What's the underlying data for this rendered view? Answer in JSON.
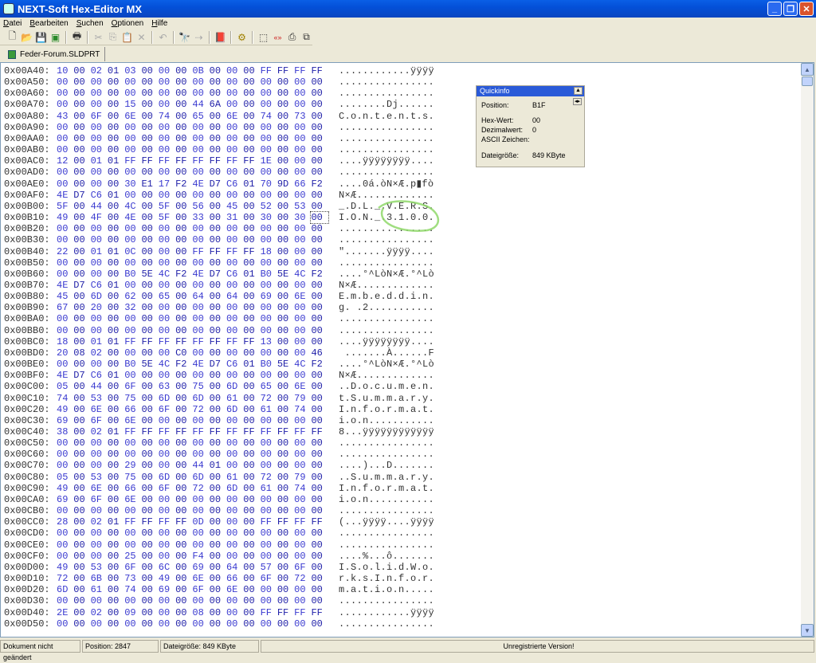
{
  "window": {
    "title": "NEXT-Soft Hex-Editor MX"
  },
  "menu": [
    "Datei",
    "Bearbeiten",
    "Suchen",
    "Optionen",
    "Hilfe"
  ],
  "tab": {
    "label": "Feder-Forum.SLDPRT"
  },
  "quickinfo": {
    "title": "Quickinfo",
    "position_label": "Position:",
    "position": "B1F",
    "hex_label": "Hex-Wert:",
    "hex": "00",
    "dec_label": "Dezimalwert:",
    "dec": "0",
    "ascii_label": "ASCII Zeichen:",
    "size_label": "Dateigröße:",
    "size": "849 KByte"
  },
  "status": {
    "doc": "Dokument nicht geändert",
    "position": "Position: 2847",
    "size": "Dateigröße: 849 KByte",
    "reg": "Unregistrierte Version!"
  },
  "colors": {
    "hex_even": "#3a3ad0",
    "hex_odd": "#1f1fa8",
    "annotation": "#8fd86a"
  },
  "cursor_offset": "0x00B1F",
  "rows": [
    [
      "0x00A40:",
      "10 00 02 01 03 00 00 00 0B 00 00 00 FF FF FF FF",
      "............ÿÿÿÿ"
    ],
    [
      "0x00A50:",
      "00 00 00 00 00 00 00 00 00 00 00 00 00 00 00 00",
      "................"
    ],
    [
      "0x00A60:",
      "00 00 00 00 00 00 00 00 00 00 00 00 00 00 00 00",
      "................"
    ],
    [
      "0x00A70:",
      "00 00 00 00 15 00 00 00 44 6A 00 00 00 00 00 00",
      "........Dj......"
    ],
    [
      "0x00A80:",
      "43 00 6F 00 6E 00 74 00 65 00 6E 00 74 00 73 00",
      "C.o.n.t.e.n.t.s."
    ],
    [
      "0x00A90:",
      "00 00 00 00 00 00 00 00 00 00 00 00 00 00 00 00",
      "................"
    ],
    [
      "0x00AA0:",
      "00 00 00 00 00 00 00 00 00 00 00 00 00 00 00 00",
      "................"
    ],
    [
      "0x00AB0:",
      "00 00 00 00 00 00 00 00 00 00 00 00 00 00 00 00",
      "................"
    ],
    [
      "0x00AC0:",
      "12 00 01 01 FF FF FF FF FF FF FF FF 1E 00 00 00",
      "....ÿÿÿÿÿÿÿÿ...."
    ],
    [
      "0x00AD0:",
      "00 00 00 00 00 00 00 00 00 00 00 00 00 00 00 00",
      "................"
    ],
    [
      "0x00AE0:",
      "00 00 00 00 30 E1 17 F2 4E D7 C6 01 70 9D 66 F2",
      "....0á.òN×Æ.p▮fò"
    ],
    [
      "0x00AF0:",
      "4E D7 C6 01 00 00 00 00 00 00 00 00 00 00 00 00",
      "N×Æ............."
    ],
    [
      "0x00B00:",
      "5F 00 44 00 4C 00 5F 00 56 00 45 00 52 00 53 00",
      "_.D.L._.V.E.R.S."
    ],
    [
      "0x00B10:",
      "49 00 4F 00 4E 00 5F 00 33 00 31 00 30 00 30 00",
      "I.O.N._.3.1.0.0."
    ],
    [
      "0x00B20:",
      "00 00 00 00 00 00 00 00 00 00 00 00 00 00 00 00",
      "................"
    ],
    [
      "0x00B30:",
      "00 00 00 00 00 00 00 00 00 00 00 00 00 00 00 00",
      "................"
    ],
    [
      "0x00B40:",
      "22 00 01 01 0C 00 00 00 FF FF FF FF 18 00 00 00",
      "\".......ÿÿÿÿ...."
    ],
    [
      "0x00B50:",
      "00 00 00 00 00 00 00 00 00 00 00 00 00 00 00 00",
      "................"
    ],
    [
      "0x00B60:",
      "00 00 00 00 B0 5E 4C F2 4E D7 C6 01 B0 5E 4C F2",
      "....°^LòN×Æ.°^Lò"
    ],
    [
      "0x00B70:",
      "4E D7 C6 01 00 00 00 00 00 00 00 00 00 00 00 00",
      "N×Æ............."
    ],
    [
      "0x00B80:",
      "45 00 6D 00 62 00 65 00 64 00 64 00 69 00 6E 00",
      "E.m.b.e.d.d.i.n."
    ],
    [
      "0x00B90:",
      "67 00 20 00 32 00 00 00 00 00 00 00 00 00 00 00",
      "g. .2..........."
    ],
    [
      "0x00BA0:",
      "00 00 00 00 00 00 00 00 00 00 00 00 00 00 00 00",
      "................"
    ],
    [
      "0x00BB0:",
      "00 00 00 00 00 00 00 00 00 00 00 00 00 00 00 00",
      "................"
    ],
    [
      "0x00BC0:",
      "18 00 01 01 FF FF FF FF FF FF FF FF 13 00 00 00",
      "....ÿÿÿÿÿÿÿÿ...."
    ],
    [
      "0x00BD0:",
      "20 08 02 00 00 00 00 C0 00 00 00 00 00 00 00 46",
      " .......À......F"
    ],
    [
      "0x00BE0:",
      "00 00 00 00 B0 5E 4C F2 4E D7 C6 01 B0 5E 4C F2",
      "....°^LòN×Æ.°^Lò"
    ],
    [
      "0x00BF0:",
      "4E D7 C6 01 00 00 00 00 00 00 00 00 00 00 00 00",
      "N×Æ............."
    ],
    [
      "0x00C00:",
      "05 00 44 00 6F 00 63 00 75 00 6D 00 65 00 6E 00",
      "..D.o.c.u.m.e.n."
    ],
    [
      "0x00C10:",
      "74 00 53 00 75 00 6D 00 6D 00 61 00 72 00 79 00",
      "t.S.u.m.m.a.r.y."
    ],
    [
      "0x00C20:",
      "49 00 6E 00 66 00 6F 00 72 00 6D 00 61 00 74 00",
      "I.n.f.o.r.m.a.t."
    ],
    [
      "0x00C30:",
      "69 00 6F 00 6E 00 00 00 00 00 00 00 00 00 00 00",
      "i.o.n..........."
    ],
    [
      "0x00C40:",
      "38 00 02 01 FF FF FF FF FF FF FF FF FF FF FF FF",
      "8...ÿÿÿÿÿÿÿÿÿÿÿÿ"
    ],
    [
      "0x00C50:",
      "00 00 00 00 00 00 00 00 00 00 00 00 00 00 00 00",
      "................"
    ],
    [
      "0x00C60:",
      "00 00 00 00 00 00 00 00 00 00 00 00 00 00 00 00",
      "................"
    ],
    [
      "0x00C70:",
      "00 00 00 00 29 00 00 00 44 01 00 00 00 00 00 00",
      "....)...D......."
    ],
    [
      "0x00C80:",
      "05 00 53 00 75 00 6D 00 6D 00 61 00 72 00 79 00",
      "..S.u.m.m.a.r.y."
    ],
    [
      "0x00C90:",
      "49 00 6E 00 66 00 6F 00 72 00 6D 00 61 00 74 00",
      "I.n.f.o.r.m.a.t."
    ],
    [
      "0x00CA0:",
      "69 00 6F 00 6E 00 00 00 00 00 00 00 00 00 00 00",
      "i.o.n..........."
    ],
    [
      "0x00CB0:",
      "00 00 00 00 00 00 00 00 00 00 00 00 00 00 00 00",
      "................"
    ],
    [
      "0x00CC0:",
      "28 00 02 01 FF FF FF FF 0D 00 00 00 FF FF FF FF",
      "(...ÿÿÿÿ....ÿÿÿÿ"
    ],
    [
      "0x00CD0:",
      "00 00 00 00 00 00 00 00 00 00 00 00 00 00 00 00",
      "................"
    ],
    [
      "0x00CE0:",
      "00 00 00 00 00 00 00 00 00 00 00 00 00 00 00 00",
      "................"
    ],
    [
      "0x00CF0:",
      "00 00 00 00 25 00 00 00 F4 00 00 00 00 00 00 00",
      "....%...ô......."
    ],
    [
      "0x00D00:",
      "49 00 53 00 6F 00 6C 00 69 00 64 00 57 00 6F 00",
      "I.S.o.l.i.d.W.o."
    ],
    [
      "0x00D10:",
      "72 00 6B 00 73 00 49 00 6E 00 66 00 6F 00 72 00",
      "r.k.s.I.n.f.o.r."
    ],
    [
      "0x00D20:",
      "6D 00 61 00 74 00 69 00 6F 00 6E 00 00 00 00 00",
      "m.a.t.i.o.n....."
    ],
    [
      "0x00D30:",
      "00 00 00 00 00 00 00 00 00 00 00 00 00 00 00 00",
      "................"
    ],
    [
      "0x00D40:",
      "2E 00 02 00 09 00 00 00 08 00 00 00 FF FF FF FF",
      "............ÿÿÿÿ"
    ],
    [
      "0x00D50:",
      "00 00 00 00 00 00 00 00 00 00 00 00 00 00 00 00",
      "................"
    ]
  ]
}
